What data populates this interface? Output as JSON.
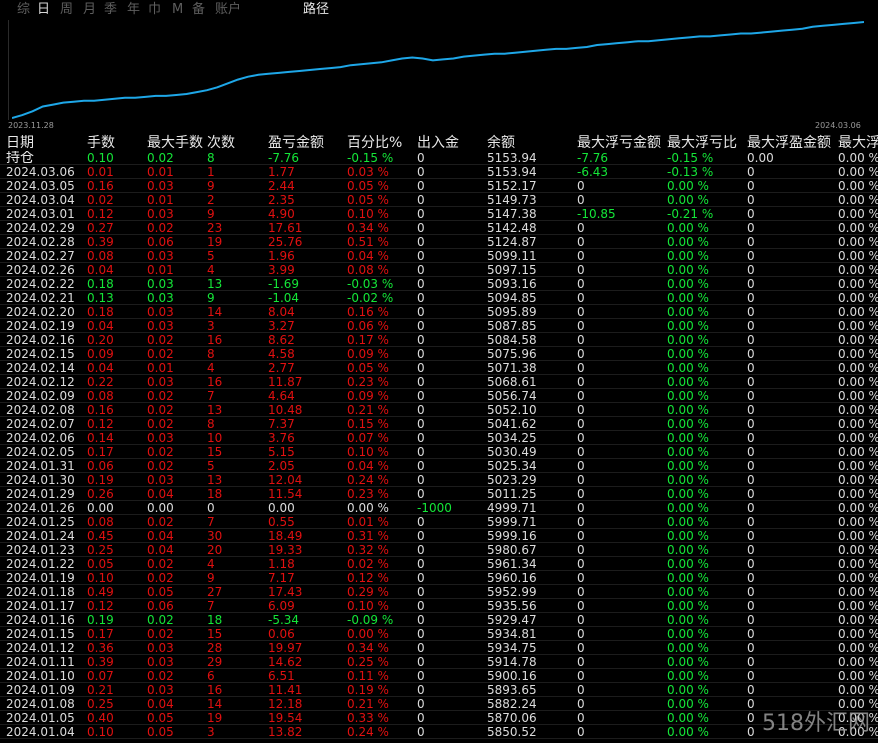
{
  "tabs": [
    {
      "label": "综"
    },
    {
      "label": "日"
    },
    {
      "label": "周"
    },
    {
      "label": "月"
    },
    {
      "label": "季"
    },
    {
      "label": "年"
    },
    {
      "label": "巾"
    },
    {
      "label": "M"
    },
    {
      "label": "备"
    },
    {
      "label": "账户"
    }
  ],
  "active_tab": "日",
  "path_label": "路径",
  "chart_data": {
    "type": "line",
    "x_start_label": "2023.11.28",
    "x_end_label": "2024.03.06",
    "line_color": "#1ea7e8",
    "values": [
      0,
      3,
      7,
      12,
      14,
      16,
      17,
      18,
      18,
      19,
      20,
      21,
      21,
      22,
      23,
      23,
      24,
      25,
      27,
      29,
      32,
      36,
      40,
      43,
      45,
      46,
      47,
      48,
      49,
      50,
      51,
      52,
      53,
      55,
      56,
      57,
      58,
      60,
      62,
      63,
      62,
      60,
      61,
      62,
      64,
      65,
      66,
      67,
      67,
      68,
      69,
      70,
      71,
      72,
      72,
      73,
      74,
      76,
      77,
      78,
      79,
      80,
      80,
      81,
      82,
      83,
      84,
      85,
      85,
      86,
      87,
      88,
      88,
      89,
      90,
      91,
      92,
      93,
      95,
      96,
      97,
      98,
      99,
      100
    ]
  },
  "columns": [
    "日期",
    "手数",
    "最大手数",
    "次数",
    "盈亏金额",
    "百分比%",
    "出入金",
    "余额",
    "最大浮亏金额",
    "最大浮亏比",
    "最大浮盈金额",
    "最大浮"
  ],
  "holding": {
    "date": "持仓",
    "lots": "0.10",
    "max_lots": "0.02",
    "count": "8",
    "pnl": "-7.76",
    "pct": "-0.15 %",
    "flow": "0",
    "balance": "5153.94",
    "mfl": "-7.76",
    "mflp": "-0.15 %",
    "mfp": "0.00",
    "mfpp": "0.00 %",
    "color": "green"
  },
  "rows": [
    {
      "date": "2024.03.06",
      "lots": "0.01",
      "max_lots": "0.01",
      "count": "1",
      "pnl": "1.77",
      "pct": "0.03 %",
      "flow": "0",
      "balance": "5153.94",
      "mfl": "-6.43",
      "mflp": "-0.13 %",
      "mfp": "0",
      "mfpp": "0.00 %",
      "color": "red",
      "mflc": "green"
    },
    {
      "date": "2024.03.05",
      "lots": "0.16",
      "max_lots": "0.03",
      "count": "9",
      "pnl": "2.44",
      "pct": "0.05 %",
      "flow": "0",
      "balance": "5152.17",
      "mfl": "0",
      "mflp": "0.00 %",
      "mfp": "0",
      "mfpp": "0.00 %",
      "color": "red"
    },
    {
      "date": "2024.03.04",
      "lots": "0.02",
      "max_lots": "0.01",
      "count": "2",
      "pnl": "2.35",
      "pct": "0.05 %",
      "flow": "0",
      "balance": "5149.73",
      "mfl": "0",
      "mflp": "0.00 %",
      "mfp": "0",
      "mfpp": "0.00 %",
      "color": "red"
    },
    {
      "date": "2024.03.01",
      "lots": "0.12",
      "max_lots": "0.03",
      "count": "9",
      "pnl": "4.90",
      "pct": "0.10 %",
      "flow": "0",
      "balance": "5147.38",
      "mfl": "-10.85",
      "mflp": "-0.21 %",
      "mfp": "0",
      "mfpp": "0.00 %",
      "color": "red",
      "mflc": "green"
    },
    {
      "date": "2024.02.29",
      "lots": "0.27",
      "max_lots": "0.02",
      "count": "23",
      "pnl": "17.61",
      "pct": "0.34 %",
      "flow": "0",
      "balance": "5142.48",
      "mfl": "0",
      "mflp": "0.00 %",
      "mfp": "0",
      "mfpp": "0.00 %",
      "color": "red"
    },
    {
      "date": "2024.02.28",
      "lots": "0.39",
      "max_lots": "0.06",
      "count": "19",
      "pnl": "25.76",
      "pct": "0.51 %",
      "flow": "0",
      "balance": "5124.87",
      "mfl": "0",
      "mflp": "0.00 %",
      "mfp": "0",
      "mfpp": "0.00 %",
      "color": "red"
    },
    {
      "date": "2024.02.27",
      "lots": "0.08",
      "max_lots": "0.03",
      "count": "5",
      "pnl": "1.96",
      "pct": "0.04 %",
      "flow": "0",
      "balance": "5099.11",
      "mfl": "0",
      "mflp": "0.00 %",
      "mfp": "0",
      "mfpp": "0.00 %",
      "color": "red"
    },
    {
      "date": "2024.02.26",
      "lots": "0.04",
      "max_lots": "0.01",
      "count": "4",
      "pnl": "3.99",
      "pct": "0.08 %",
      "flow": "0",
      "balance": "5097.15",
      "mfl": "0",
      "mflp": "0.00 %",
      "mfp": "0",
      "mfpp": "0.00 %",
      "color": "red"
    },
    {
      "date": "2024.02.22",
      "lots": "0.18",
      "max_lots": "0.03",
      "count": "13",
      "pnl": "-1.69",
      "pct": "-0.03 %",
      "flow": "0",
      "balance": "5093.16",
      "mfl": "0",
      "mflp": "0.00 %",
      "mfp": "0",
      "mfpp": "0.00 %",
      "color": "green"
    },
    {
      "date": "2024.02.21",
      "lots": "0.13",
      "max_lots": "0.03",
      "count": "9",
      "pnl": "-1.04",
      "pct": "-0.02 %",
      "flow": "0",
      "balance": "5094.85",
      "mfl": "0",
      "mflp": "0.00 %",
      "mfp": "0",
      "mfpp": "0.00 %",
      "color": "green"
    },
    {
      "date": "2024.02.20",
      "lots": "0.18",
      "max_lots": "0.03",
      "count": "14",
      "pnl": "8.04",
      "pct": "0.16 %",
      "flow": "0",
      "balance": "5095.89",
      "mfl": "0",
      "mflp": "0.00 %",
      "mfp": "0",
      "mfpp": "0.00 %",
      "color": "red"
    },
    {
      "date": "2024.02.19",
      "lots": "0.04",
      "max_lots": "0.03",
      "count": "3",
      "pnl": "3.27",
      "pct": "0.06 %",
      "flow": "0",
      "balance": "5087.85",
      "mfl": "0",
      "mflp": "0.00 %",
      "mfp": "0",
      "mfpp": "0.00 %",
      "color": "red"
    },
    {
      "date": "2024.02.16",
      "lots": "0.20",
      "max_lots": "0.02",
      "count": "16",
      "pnl": "8.62",
      "pct": "0.17 %",
      "flow": "0",
      "balance": "5084.58",
      "mfl": "0",
      "mflp": "0.00 %",
      "mfp": "0",
      "mfpp": "0.00 %",
      "color": "red"
    },
    {
      "date": "2024.02.15",
      "lots": "0.09",
      "max_lots": "0.02",
      "count": "8",
      "pnl": "4.58",
      "pct": "0.09 %",
      "flow": "0",
      "balance": "5075.96",
      "mfl": "0",
      "mflp": "0.00 %",
      "mfp": "0",
      "mfpp": "0.00 %",
      "color": "red"
    },
    {
      "date": "2024.02.14",
      "lots": "0.04",
      "max_lots": "0.01",
      "count": "4",
      "pnl": "2.77",
      "pct": "0.05 %",
      "flow": "0",
      "balance": "5071.38",
      "mfl": "0",
      "mflp": "0.00 %",
      "mfp": "0",
      "mfpp": "0.00 %",
      "color": "red"
    },
    {
      "date": "2024.02.12",
      "lots": "0.22",
      "max_lots": "0.03",
      "count": "16",
      "pnl": "11.87",
      "pct": "0.23 %",
      "flow": "0",
      "balance": "5068.61",
      "mfl": "0",
      "mflp": "0.00 %",
      "mfp": "0",
      "mfpp": "0.00 %",
      "color": "red"
    },
    {
      "date": "2024.02.09",
      "lots": "0.08",
      "max_lots": "0.02",
      "count": "7",
      "pnl": "4.64",
      "pct": "0.09 %",
      "flow": "0",
      "balance": "5056.74",
      "mfl": "0",
      "mflp": "0.00 %",
      "mfp": "0",
      "mfpp": "0.00 %",
      "color": "red"
    },
    {
      "date": "2024.02.08",
      "lots": "0.16",
      "max_lots": "0.02",
      "count": "13",
      "pnl": "10.48",
      "pct": "0.21 %",
      "flow": "0",
      "balance": "5052.10",
      "mfl": "0",
      "mflp": "0.00 %",
      "mfp": "0",
      "mfpp": "0.00 %",
      "color": "red"
    },
    {
      "date": "2024.02.07",
      "lots": "0.12",
      "max_lots": "0.02",
      "count": "8",
      "pnl": "7.37",
      "pct": "0.15 %",
      "flow": "0",
      "balance": "5041.62",
      "mfl": "0",
      "mflp": "0.00 %",
      "mfp": "0",
      "mfpp": "0.00 %",
      "color": "red"
    },
    {
      "date": "2024.02.06",
      "lots": "0.14",
      "max_lots": "0.03",
      "count": "10",
      "pnl": "3.76",
      "pct": "0.07 %",
      "flow": "0",
      "balance": "5034.25",
      "mfl": "0",
      "mflp": "0.00 %",
      "mfp": "0",
      "mfpp": "0.00 %",
      "color": "red"
    },
    {
      "date": "2024.02.05",
      "lots": "0.17",
      "max_lots": "0.02",
      "count": "15",
      "pnl": "5.15",
      "pct": "0.10 %",
      "flow": "0",
      "balance": "5030.49",
      "mfl": "0",
      "mflp": "0.00 %",
      "mfp": "0",
      "mfpp": "0.00 %",
      "color": "red"
    },
    {
      "date": "2024.01.31",
      "lots": "0.06",
      "max_lots": "0.02",
      "count": "5",
      "pnl": "2.05",
      "pct": "0.04 %",
      "flow": "0",
      "balance": "5025.34",
      "mfl": "0",
      "mflp": "0.00 %",
      "mfp": "0",
      "mfpp": "0.00 %",
      "color": "red"
    },
    {
      "date": "2024.01.30",
      "lots": "0.19",
      "max_lots": "0.03",
      "count": "13",
      "pnl": "12.04",
      "pct": "0.24 %",
      "flow": "0",
      "balance": "5023.29",
      "mfl": "0",
      "mflp": "0.00 %",
      "mfp": "0",
      "mfpp": "0.00 %",
      "color": "red"
    },
    {
      "date": "2024.01.29",
      "lots": "0.26",
      "max_lots": "0.04",
      "count": "18",
      "pnl": "11.54",
      "pct": "0.23 %",
      "flow": "0",
      "balance": "5011.25",
      "mfl": "0",
      "mflp": "0.00 %",
      "mfp": "0",
      "mfpp": "0.00 %",
      "color": "red"
    },
    {
      "date": "2024.01.26",
      "lots": "0.00",
      "max_lots": "0.00",
      "count": "0",
      "pnl": "0.00",
      "pct": "0.00 %",
      "flow": "-1000",
      "balance": "4999.71",
      "mfl": "0",
      "mflp": "0.00 %",
      "mfp": "0",
      "mfpp": "0.00 %",
      "color": "white",
      "flowc": "green"
    },
    {
      "date": "2024.01.25",
      "lots": "0.08",
      "max_lots": "0.02",
      "count": "7",
      "pnl": "0.55",
      "pct": "0.01 %",
      "flow": "0",
      "balance": "5999.71",
      "mfl": "0",
      "mflp": "0.00 %",
      "mfp": "0",
      "mfpp": "0.00 %",
      "color": "red"
    },
    {
      "date": "2024.01.24",
      "lots": "0.45",
      "max_lots": "0.04",
      "count": "30",
      "pnl": "18.49",
      "pct": "0.31 %",
      "flow": "0",
      "balance": "5999.16",
      "mfl": "0",
      "mflp": "0.00 %",
      "mfp": "0",
      "mfpp": "0.00 %",
      "color": "red"
    },
    {
      "date": "2024.01.23",
      "lots": "0.25",
      "max_lots": "0.04",
      "count": "20",
      "pnl": "19.33",
      "pct": "0.32 %",
      "flow": "0",
      "balance": "5980.67",
      "mfl": "0",
      "mflp": "0.00 %",
      "mfp": "0",
      "mfpp": "0.00 %",
      "color": "red"
    },
    {
      "date": "2024.01.22",
      "lots": "0.05",
      "max_lots": "0.02",
      "count": "4",
      "pnl": "1.18",
      "pct": "0.02 %",
      "flow": "0",
      "balance": "5961.34",
      "mfl": "0",
      "mflp": "0.00 %",
      "mfp": "0",
      "mfpp": "0.00 %",
      "color": "red"
    },
    {
      "date": "2024.01.19",
      "lots": "0.10",
      "max_lots": "0.02",
      "count": "9",
      "pnl": "7.17",
      "pct": "0.12 %",
      "flow": "0",
      "balance": "5960.16",
      "mfl": "0",
      "mflp": "0.00 %",
      "mfp": "0",
      "mfpp": "0.00 %",
      "color": "red"
    },
    {
      "date": "2024.01.18",
      "lots": "0.49",
      "max_lots": "0.05",
      "count": "27",
      "pnl": "17.43",
      "pct": "0.29 %",
      "flow": "0",
      "balance": "5952.99",
      "mfl": "0",
      "mflp": "0.00 %",
      "mfp": "0",
      "mfpp": "0.00 %",
      "color": "red"
    },
    {
      "date": "2024.01.17",
      "lots": "0.12",
      "max_lots": "0.06",
      "count": "7",
      "pnl": "6.09",
      "pct": "0.10 %",
      "flow": "0",
      "balance": "5935.56",
      "mfl": "0",
      "mflp": "0.00 %",
      "mfp": "0",
      "mfpp": "0.00 %",
      "color": "red"
    },
    {
      "date": "2024.01.16",
      "lots": "0.19",
      "max_lots": "0.02",
      "count": "18",
      "pnl": "-5.34",
      "pct": "-0.09 %",
      "flow": "0",
      "balance": "5929.47",
      "mfl": "0",
      "mflp": "0.00 %",
      "mfp": "0",
      "mfpp": "0.00 %",
      "color": "green"
    },
    {
      "date": "2024.01.15",
      "lots": "0.17",
      "max_lots": "0.02",
      "count": "15",
      "pnl": "0.06",
      "pct": "0.00 %",
      "flow": "0",
      "balance": "5934.81",
      "mfl": "0",
      "mflp": "0.00 %",
      "mfp": "0",
      "mfpp": "0.00 %",
      "color": "red"
    },
    {
      "date": "2024.01.12",
      "lots": "0.36",
      "max_lots": "0.03",
      "count": "28",
      "pnl": "19.97",
      "pct": "0.34 %",
      "flow": "0",
      "balance": "5934.75",
      "mfl": "0",
      "mflp": "0.00 %",
      "mfp": "0",
      "mfpp": "0.00 %",
      "color": "red"
    },
    {
      "date": "2024.01.11",
      "lots": "0.39",
      "max_lots": "0.03",
      "count": "29",
      "pnl": "14.62",
      "pct": "0.25 %",
      "flow": "0",
      "balance": "5914.78",
      "mfl": "0",
      "mflp": "0.00 %",
      "mfp": "0",
      "mfpp": "0.00 %",
      "color": "red"
    },
    {
      "date": "2024.01.10",
      "lots": "0.07",
      "max_lots": "0.02",
      "count": "6",
      "pnl": "6.51",
      "pct": "0.11 %",
      "flow": "0",
      "balance": "5900.16",
      "mfl": "0",
      "mflp": "0.00 %",
      "mfp": "0",
      "mfpp": "0.00 %",
      "color": "red"
    },
    {
      "date": "2024.01.09",
      "lots": "0.21",
      "max_lots": "0.03",
      "count": "16",
      "pnl": "11.41",
      "pct": "0.19 %",
      "flow": "0",
      "balance": "5893.65",
      "mfl": "0",
      "mflp": "0.00 %",
      "mfp": "0",
      "mfpp": "0.00 %",
      "color": "red"
    },
    {
      "date": "2024.01.08",
      "lots": "0.25",
      "max_lots": "0.04",
      "count": "14",
      "pnl": "12.18",
      "pct": "0.21 %",
      "flow": "0",
      "balance": "5882.24",
      "mfl": "0",
      "mflp": "0.00 %",
      "mfp": "0",
      "mfpp": "0.00 %",
      "color": "red"
    },
    {
      "date": "2024.01.05",
      "lots": "0.40",
      "max_lots": "0.05",
      "count": "19",
      "pnl": "19.54",
      "pct": "0.33 %",
      "flow": "0",
      "balance": "5870.06",
      "mfl": "0",
      "mflp": "0.00 %",
      "mfp": "0",
      "mfpp": "0.00 %",
      "color": "red"
    },
    {
      "date": "2024.01.04",
      "lots": "0.10",
      "max_lots": "0.05",
      "count": "3",
      "pnl": "13.82",
      "pct": "0.24 %",
      "flow": "0",
      "balance": "5850.52",
      "mfl": "0",
      "mflp": "0.00 %",
      "mfp": "0",
      "mfpp": "0.00 %",
      "color": "red"
    }
  ],
  "watermark": "518外汇网",
  "colors": {
    "positive": "#14e638",
    "negative": "#e01010",
    "neutral": "#dcdcdc",
    "line": "#1ea7e8",
    "background": "#000000"
  }
}
